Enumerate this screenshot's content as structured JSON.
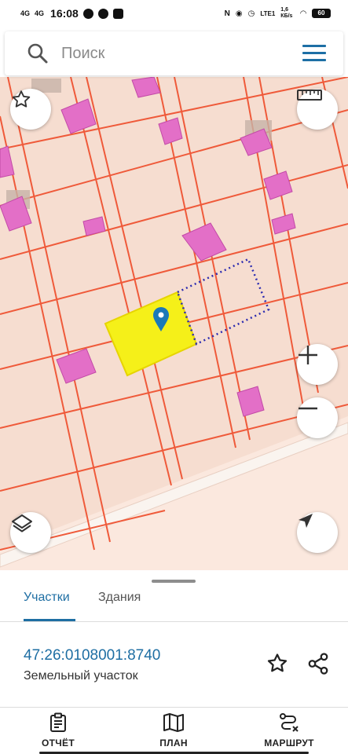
{
  "status_bar": {
    "network_1": "4G",
    "network_2": "4G",
    "time": "16:08",
    "lte_label": "LTE1",
    "speed": "1,6 КБ/s",
    "battery": "60"
  },
  "search": {
    "placeholder": "Поиск"
  },
  "map": {
    "colors": {
      "background": "#f6ddd0",
      "parcel_border": "#ef5a3a",
      "building": "#e36fc7",
      "selected_parcel": "#f5f019",
      "dotted_outline": "#2b2bb0",
      "road": "#faf3ee",
      "pin": "#1a79b8"
    },
    "controls": {
      "favorites": "star-icon",
      "ruler": "ruler-icon",
      "zoom_in": "+",
      "zoom_out": "−",
      "layers": "layers-icon",
      "locate": "navigation-arrow-icon"
    }
  },
  "sheet": {
    "tabs": [
      {
        "label": "Участки",
        "active": true
      },
      {
        "label": "Здания",
        "active": false
      }
    ],
    "parcel": {
      "cadastral_number": "47:26:0108001:8740",
      "type": "Земельный участок"
    }
  },
  "bottom_nav": {
    "items": [
      {
        "label": "ОТЧЁТ",
        "icon": "report-icon"
      },
      {
        "label": "ПЛАН",
        "icon": "map-plan-icon"
      },
      {
        "label": "МАРШРУТ",
        "icon": "route-icon"
      }
    ]
  }
}
